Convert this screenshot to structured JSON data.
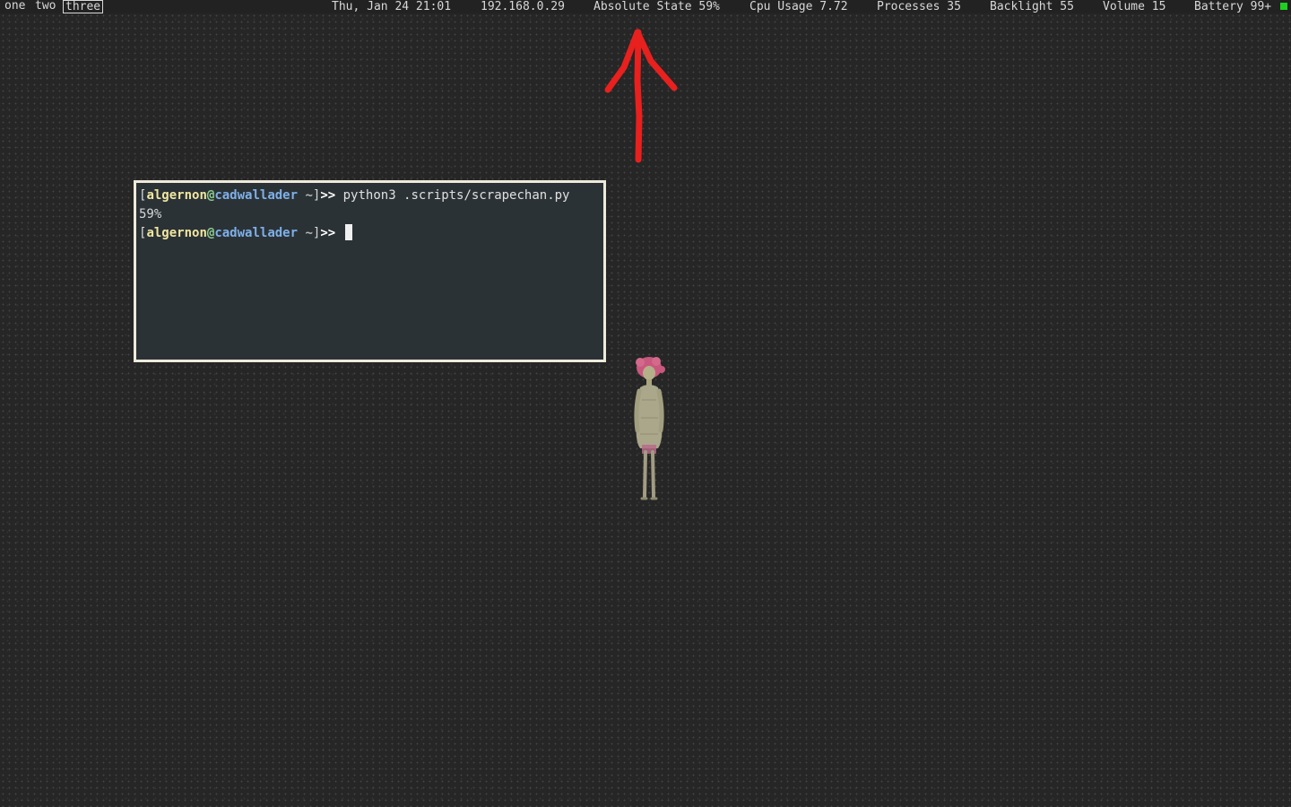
{
  "workspaces": [
    {
      "label": "one",
      "active": false
    },
    {
      "label": "two",
      "active": false
    },
    {
      "label": "three",
      "active": true
    }
  ],
  "status": {
    "datetime": "Thu, Jan 24 21:01",
    "ip": "192.168.0.29",
    "absolute_state": "Absolute State 59%",
    "cpu": "Cpu Usage 7.72",
    "processes": "Processes 35",
    "backlight": "Backlight 55",
    "volume": "Volume 15",
    "battery": "Battery 99+",
    "battery_indicator_color": "#1fd11f"
  },
  "annotation": {
    "icon": "red-arrow-up-icon",
    "color": "#e8201e"
  },
  "terminal": {
    "prompt": {
      "open": "[",
      "user": "algernon",
      "at": "@",
      "host": "cadwallader",
      "dir": " ~",
      "close": "]",
      "arrows": ">>"
    },
    "command": "python3 .scripts/scrapechan.py",
    "output": "59%",
    "border_color": "#eeeadb",
    "background": "#2b3236"
  },
  "wallpaper": {
    "icon": "standing-girl-figure-icon"
  }
}
